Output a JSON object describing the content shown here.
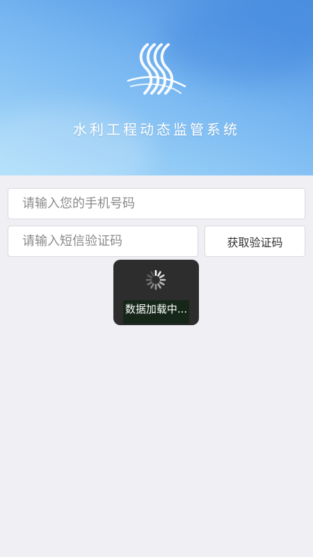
{
  "header": {
    "logo_icon": "water-waves-logo-icon",
    "title": "水利工程动态监管系统",
    "background_colors": [
      "#4b8fe0",
      "#a8dcfa"
    ]
  },
  "login_form": {
    "phone_placeholder": "请输入您的手机号码",
    "phone_value": "",
    "code_placeholder": "请输入短信验证码",
    "code_value": "",
    "get_code_label": "获取验证码"
  },
  "loading_toast": {
    "icon": "spinner-icon",
    "text": "数据加载中..."
  }
}
